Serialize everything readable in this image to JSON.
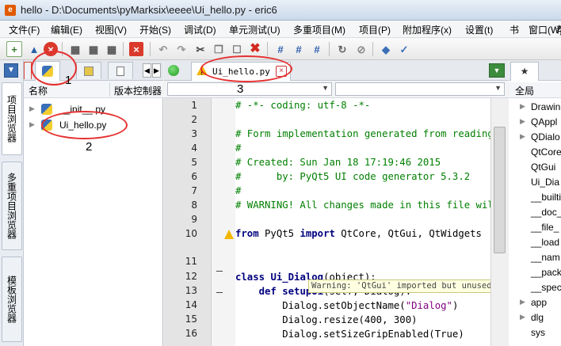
{
  "window": {
    "title": "hello - D:\\Documents\\pyMarksix\\eeee\\Ui_hello.py - eric6"
  },
  "menu": [
    "文件(F)",
    "编辑(E)",
    "视图(V)",
    "开始(S)",
    "调试(D)",
    "单元测试(U)",
    "多重项目(M)",
    "项目(P)",
    "附加程序(x)",
    "设置(t)",
    "书",
    "窗口(W)",
    "帮"
  ],
  "left_vtabs": [
    "项目浏览器",
    "多重项目浏览器",
    "模板浏览器"
  ],
  "left_pane": {
    "columns": [
      "名称",
      "版本控制器"
    ],
    "items": [
      "__init__.py",
      "Ui_hello.py"
    ]
  },
  "editor": {
    "tab_label": "Ui_hello.py",
    "line_numbers": [
      "1",
      "2",
      "3",
      "4",
      "5",
      "6",
      "7",
      "8",
      "9",
      "10",
      "",
      "11",
      "12",
      "13",
      "14",
      "15",
      "16"
    ],
    "lines": [
      {
        "t": "comment",
        "text": "# -*- coding: utf-8 -*-"
      },
      {
        "t": "blank",
        "text": ""
      },
      {
        "t": "comment",
        "text": "# Form implementation generated from reading ui file '"
      },
      {
        "t": "comment",
        "text": "#"
      },
      {
        "t": "comment",
        "text": "# Created: Sun Jan 18 17:19:46 2015"
      },
      {
        "t": "comment",
        "text": "#      by: PyQt5 UI code generator 5.3.2"
      },
      {
        "t": "comment",
        "text": "#"
      },
      {
        "t": "comment",
        "text": "# WARNING! All changes made in this file will be lost"
      },
      {
        "t": "blank",
        "text": ""
      },
      {
        "t": "import",
        "text": "from PyQt5 import QtCore, QtGui, QtWidgets"
      },
      {
        "t": "blank",
        "text": ""
      },
      {
        "t": "blank",
        "text": ""
      },
      {
        "t": "class",
        "text": "class Ui_Dialog(object):"
      },
      {
        "t": "def",
        "text": "    def setupUi(self, Dialog):"
      },
      {
        "t": "call1",
        "text": "        Dialog.setObjectName(\"Dialog\")"
      },
      {
        "t": "plain",
        "text": "        Dialog.resize(400, 300)"
      },
      {
        "t": "plain",
        "text": "        Dialog.setSizeGripEnabled(True)"
      }
    ],
    "warning_text": "Warning: 'QtGui' imported but unused."
  },
  "right_pane": {
    "header": "全局",
    "items": [
      "Drawin",
      "QAppl",
      "QDialo",
      "QtCore",
      "QtGui",
      "Ui_Dia",
      "__builti",
      "__doc_",
      "__file_",
      "__load",
      "__nam",
      "__pack",
      "__spec",
      "app",
      "dlg",
      "sys"
    ],
    "expandable": [
      true,
      true,
      true,
      false,
      false,
      false,
      false,
      false,
      false,
      false,
      false,
      false,
      false,
      true,
      true,
      false
    ]
  },
  "annotations": [
    "1",
    "2",
    "3"
  ],
  "colors": {
    "comment": "#007f00",
    "keyword": "#00007f",
    "string": "#7f007f",
    "accent_ring": "#e53030"
  },
  "icons": [
    "new-file-icon",
    "open-icon",
    "close-icon",
    "save-icon",
    "save-as-icon",
    "save-all-icon",
    "close-red-icon",
    "undo-icon",
    "redo-icon",
    "cut-icon",
    "copy-icon",
    "paste-icon",
    "delete-icon",
    "comment-icon",
    "uncomment-icon",
    "toggle-comment-icon",
    "search-icon",
    "stop-icon",
    "python-icon",
    "spellcheck-icon"
  ]
}
